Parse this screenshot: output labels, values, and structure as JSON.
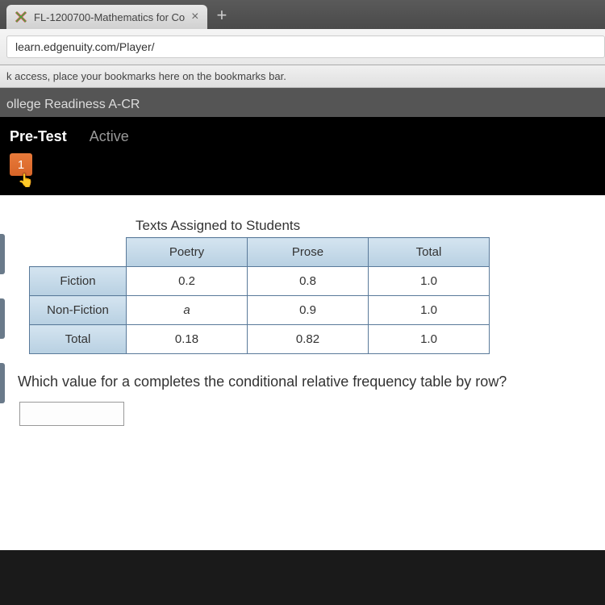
{
  "browser": {
    "tab_title": "FL-1200700-Mathematics for Co",
    "url": "learn.edgenuity.com/Player/",
    "bookmark_hint": "k access, place your bookmarks here on the bookmarks bar."
  },
  "header": {
    "course": "ollege Readiness A-CR",
    "pretest_label": "Pre-Test",
    "active_label": "Active",
    "question_number": "1"
  },
  "table": {
    "title": "Texts Assigned to Students",
    "col_headers": [
      "Poetry",
      "Prose",
      "Total"
    ],
    "rows": [
      {
        "label": "Fiction",
        "cells": [
          "0.2",
          "0.8",
          "1.0"
        ]
      },
      {
        "label": "Non-Fiction",
        "cells": [
          "a",
          "0.9",
          "1.0"
        ]
      },
      {
        "label": "Total",
        "cells": [
          "0.18",
          "0.82",
          "1.0"
        ]
      }
    ]
  },
  "question": {
    "text": "Which value for a completes the conditional relative frequency table by row?",
    "answer_value": ""
  }
}
